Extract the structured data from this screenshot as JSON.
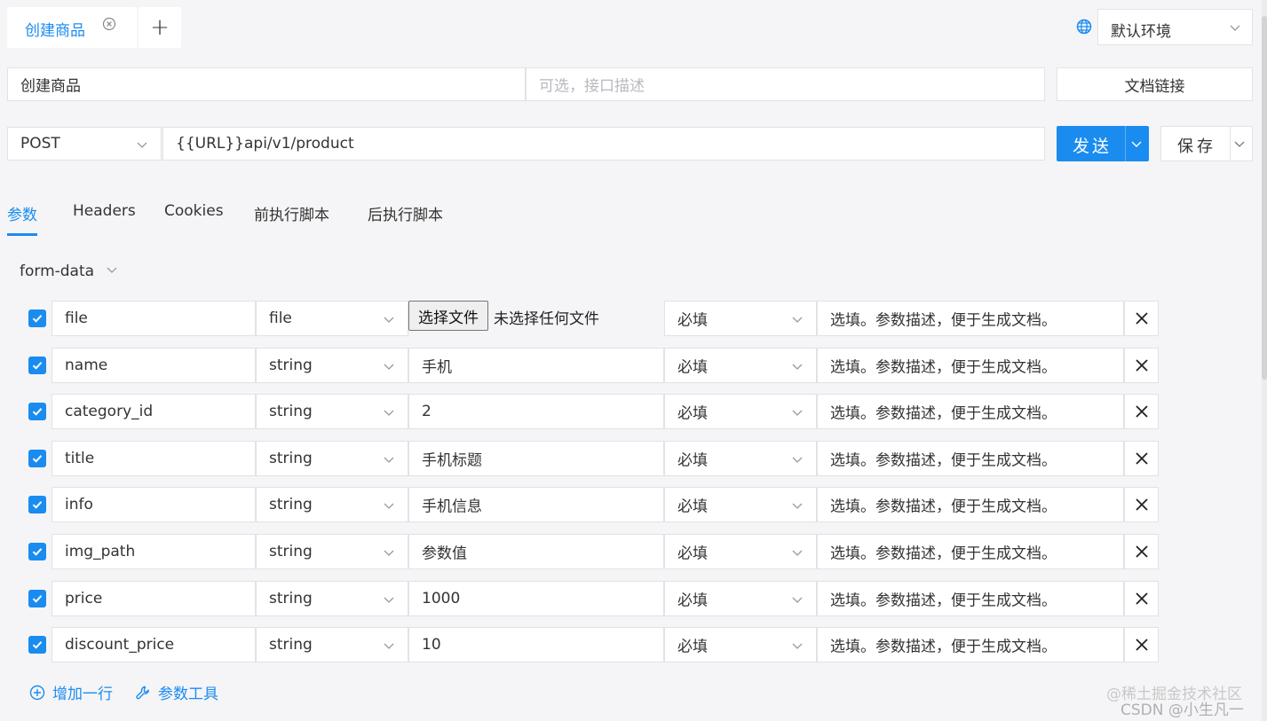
{
  "tabs": [
    {
      "label": "创建商品",
      "active": true
    }
  ],
  "add_tab_label": "+",
  "environment": {
    "selected": "默认环境"
  },
  "request": {
    "name": "创建商品",
    "description_placeholder": "可选，接口描述",
    "doc_link_label": "文档链接",
    "method": "POST",
    "url": "{{URL}}api/v1/product",
    "send_label": "发送",
    "save_label": "保存"
  },
  "subtabs": [
    "参数",
    "Headers",
    "Cookies",
    "前执行脚本",
    "后执行脚本"
  ],
  "body_type": "form-data",
  "params": [
    {
      "checked": true,
      "name": "file",
      "type": "file",
      "value": "",
      "file_button": "选择文件",
      "file_status": "未选择任何文件",
      "required": "必填"
    },
    {
      "checked": true,
      "name": "name",
      "type": "string",
      "value": "手机",
      "required": "必填"
    },
    {
      "checked": true,
      "name": "category_id",
      "type": "string",
      "value": "2",
      "required": "必填"
    },
    {
      "checked": true,
      "name": "title",
      "type": "string",
      "value": "手机标题",
      "required": "必填"
    },
    {
      "checked": true,
      "name": "info",
      "type": "string",
      "value": "手机信息",
      "required": "必填"
    },
    {
      "checked": true,
      "name": "img_path",
      "type": "string",
      "value": "",
      "required": "必填"
    },
    {
      "checked": true,
      "name": "price",
      "type": "string",
      "value": "1000",
      "required": "必填"
    },
    {
      "checked": true,
      "name": "discount_price",
      "type": "string",
      "value": "10",
      "required": "必填"
    }
  ],
  "value_placeholder": "参数值",
  "desc_placeholder": "选填。参数描述，便于生成文档。",
  "add_row_label": "增加一行",
  "param_tools_label": "参数工具",
  "watermark": {
    "line1": "@稀土掘金技术社区",
    "line2": "CSDN @小生凡一"
  },
  "colors": {
    "accent": "#1a8cf0",
    "background": "#f5f5f7"
  }
}
